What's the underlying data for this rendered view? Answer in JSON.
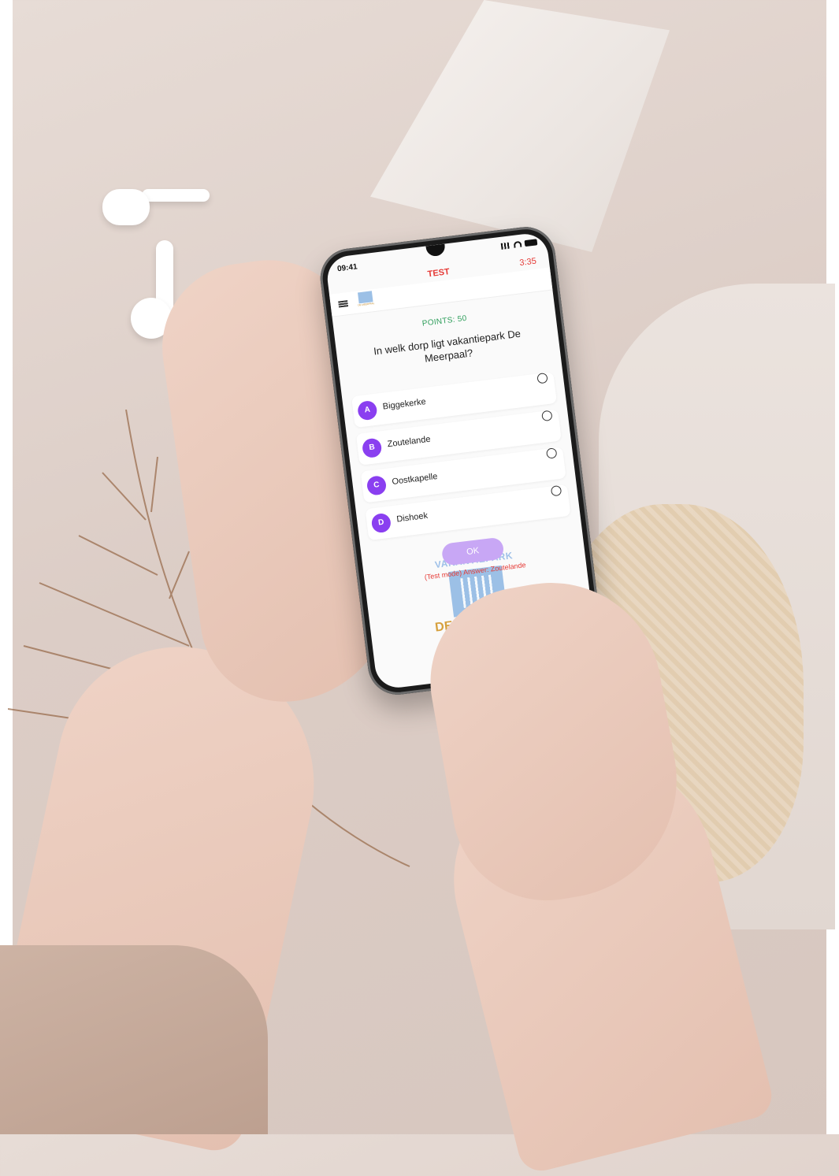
{
  "status_bar": {
    "time": "09:41"
  },
  "header": {
    "title": "TEST",
    "timer": "3:35"
  },
  "nav": {
    "logo_text": "DE MEERPAAL"
  },
  "quiz": {
    "points_label": "POINTS: 50",
    "question": "In welk dorp ligt vakantiepark De Meerpaal?",
    "options": [
      {
        "letter": "A",
        "label": "Biggekerke"
      },
      {
        "letter": "B",
        "label": "Zoutelande"
      },
      {
        "letter": "C",
        "label": "Oostkapelle"
      },
      {
        "letter": "D",
        "label": "Dishoek"
      }
    ],
    "ok_label": "OK",
    "answer_hint": "(Test mode) Answer: Zoutelande"
  },
  "logo": {
    "top": "VAKANTIEPARK",
    "bottom": "DE MEERPAAL"
  },
  "colors": {
    "accent": "#8a3ff0",
    "ok_button": "#c8a7f5",
    "points": "#2e9e5b",
    "alert": "#e53935"
  },
  "icons": [
    "hamburger-menu-icon",
    "signal-icon",
    "wifi-icon",
    "battery-icon"
  ]
}
